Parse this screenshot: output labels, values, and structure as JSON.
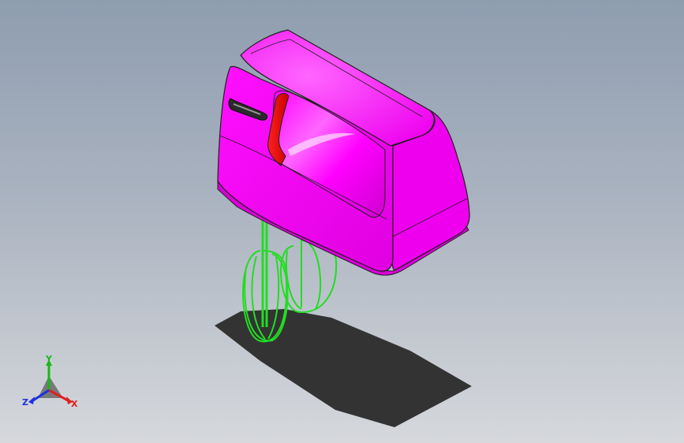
{
  "viewport": {
    "background_top": "#8f9db0",
    "background_bottom": "#d6d8dc"
  },
  "model": {
    "body_color": "#ff00ff",
    "body_dark": "#c800c8",
    "trigger_color": "#ff1a1a",
    "beater_color": "#22dd22",
    "shadow_color": "#333333"
  },
  "triad": {
    "x_label": "X",
    "y_label": "Y",
    "z_label": "Z",
    "x_color": "#e02020",
    "y_color": "#18b818",
    "z_color": "#2030e0"
  }
}
